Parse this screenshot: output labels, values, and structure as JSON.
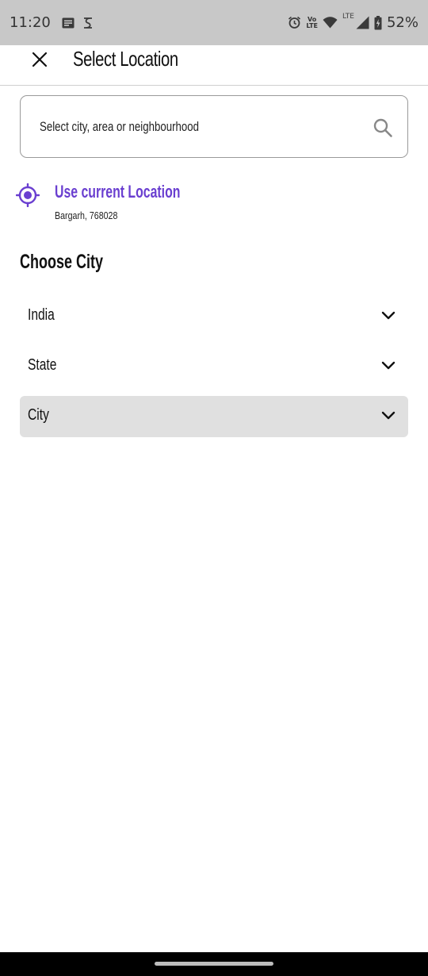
{
  "status_bar": {
    "time": "11:20",
    "battery": "52%",
    "network_label": "LTE",
    "volte_top": "Vo",
    "volte_bottom": "LTE"
  },
  "header": {
    "title": "Select Location"
  },
  "search": {
    "placeholder": "Select city, area or neighbourhood"
  },
  "current_location": {
    "title": "Use current Location",
    "subtitle": "Bargarh, 768028"
  },
  "choose_city": {
    "title": "Choose City",
    "dropdowns": [
      {
        "label": "India"
      },
      {
        "label": "State"
      },
      {
        "label": "City"
      }
    ]
  },
  "colors": {
    "accent": "#6a3fd0",
    "status_bar_bg": "#c8c8c8",
    "active_dropdown_bg": "#e0e0e0"
  }
}
